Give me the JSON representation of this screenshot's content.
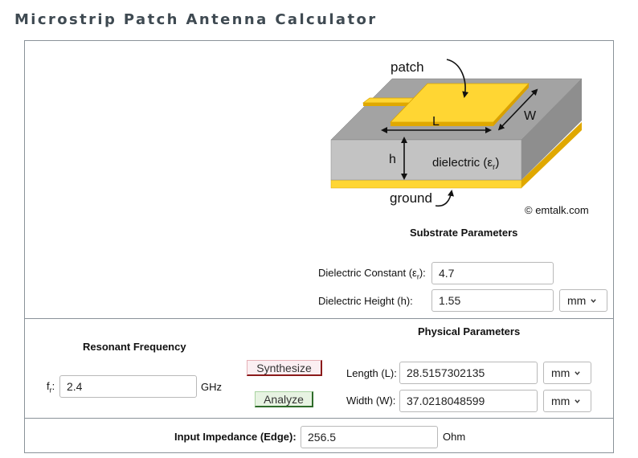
{
  "page_title": "Microstrip Patch Antenna Calculator",
  "diagram": {
    "patch_label": "patch",
    "length_label": "L",
    "width_label": "W",
    "height_label": "h",
    "dielectric_label": "dielectric (ε",
    "dielectric_sub": "r",
    "dielectric_close": ")",
    "ground_label": "ground",
    "copyright": "© emtalk.com"
  },
  "substrate": {
    "heading": "Substrate Parameters",
    "dielectric_constant_label": "Dielectric Constant (ε",
    "dielectric_constant_sub": "r",
    "dielectric_constant_close": "):",
    "dielectric_constant_value": "4.7",
    "dielectric_height_label": "Dielectric Height (h):",
    "dielectric_height_value": "1.55",
    "dielectric_height_unit": "mm"
  },
  "resonant": {
    "heading": "Resonant Frequency",
    "freq_label": "f",
    "freq_sub": "r",
    "freq_colon": ":",
    "freq_value": "2.4",
    "freq_unit": "GHz"
  },
  "buttons": {
    "synthesize": "Synthesize",
    "analyze": "Analyze"
  },
  "physical": {
    "heading": "Physical Parameters",
    "length_label": "Length (L):",
    "length_value": "28.5157302135",
    "length_unit": "mm",
    "width_label": "Width (W):",
    "width_value": "37.0218048599",
    "width_unit": "mm"
  },
  "impedance": {
    "label": "Input Impedance (Edge):",
    "value": "256.5",
    "unit": "Ohm"
  },
  "colors": {
    "copper": "#ffd633",
    "copper_dark": "#e0a800",
    "substrate_top": "#a3a3a3",
    "substrate_front": "#c3c3c3",
    "substrate_side": "#8e8e8e"
  }
}
